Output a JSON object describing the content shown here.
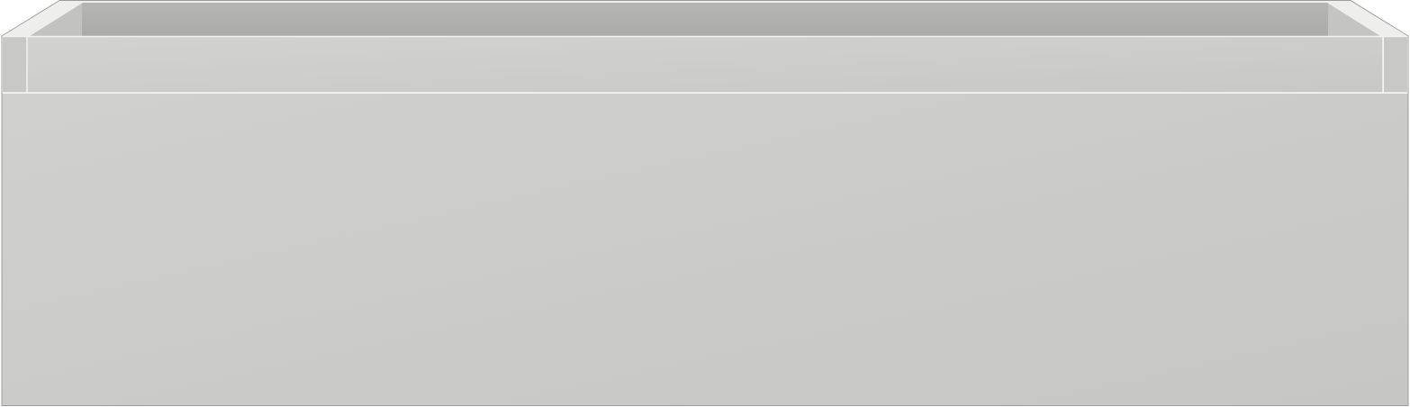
{
  "colors": {
    "front_panel_top": "#d0d0ce",
    "front_panel_bottom": "#c6c6c4",
    "drawer_front_top": "#d2d2d0",
    "drawer_front_bottom": "#c8c8c6",
    "inner_back_wall_top": "#b6b6b4",
    "inner_back_wall_bottom": "#aaaaa8",
    "side_wall_left": "#c2c2c0",
    "side_wall_right": "#c4c4c2",
    "side_post": "#c8c8c6",
    "rim": "#eeeeec",
    "edge_line": "#9c9c9a",
    "seam_line": "#f2f2f0",
    "background": "#ffffff"
  }
}
